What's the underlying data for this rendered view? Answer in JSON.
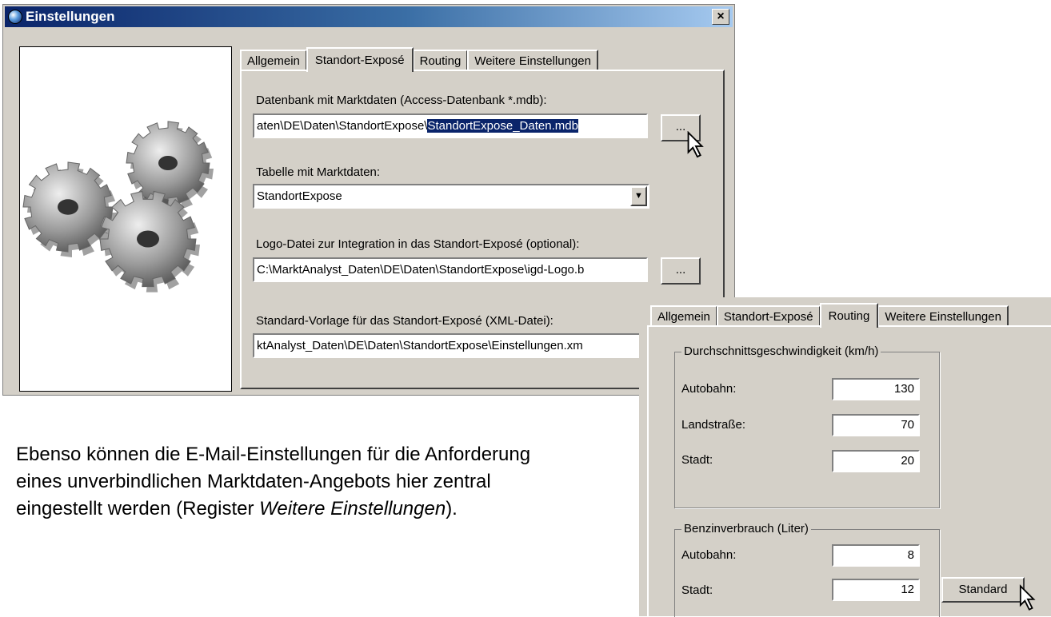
{
  "window": {
    "title": "Einstellungen",
    "close_label": "×"
  },
  "main_tabs": [
    "Allgemein",
    "Standort-Exposé",
    "Routing",
    "Weitere Einstellungen"
  ],
  "standort": {
    "db_label": "Datenbank mit Marktdaten (Access-Datenbank *.mdb):",
    "db_path_prefix": "aten\\DE\\Daten\\StandortExpose\\",
    "db_path_selected": "StandortExpose_Daten.mdb",
    "browse_label": "...",
    "table_label": "Tabelle mit Marktdaten:",
    "table_value": "StandortExpose",
    "logo_label": "Logo-Datei zur Integration in das Standort-Exposé (optional):",
    "logo_path": "C:\\MarktAnalyst_Daten\\DE\\Daten\\StandortExpose\\igd-Logo.b",
    "template_label": "Standard-Vorlage für das Standort-Exposé (XML-Datei):",
    "template_path": "ktAnalyst_Daten\\DE\\Daten\\StandortExpose\\Einstellungen.xm"
  },
  "body_text": {
    "line1": "Ebenso können die E-Mail-Einstellungen für die Anforderung",
    "line2": "eines unverbindlichen Marktdaten-Angebots hier zentral",
    "line3_start": "eingestellt werden (Register ",
    "line3_italic": "Weitere Einstellungen",
    "line3_end": ")."
  },
  "routing_tabs": [
    "Allgemein",
    "Standort-Exposé",
    "Routing",
    "Weitere Einstellungen"
  ],
  "routing": {
    "speed_group": "Durchschnittsgeschwindigkeit (km/h)",
    "speed_rows": [
      {
        "label": "Autobahn:",
        "value": "130"
      },
      {
        "label": "Landstraße:",
        "value": "70"
      },
      {
        "label": "Stadt:",
        "value": "20"
      }
    ],
    "fuel_group": "Benzinverbrauch (Liter)",
    "fuel_rows": [
      {
        "label": "Autobahn:",
        "value": "8"
      },
      {
        "label": "Stadt:",
        "value": "12"
      }
    ],
    "standard_button": "Standard"
  }
}
